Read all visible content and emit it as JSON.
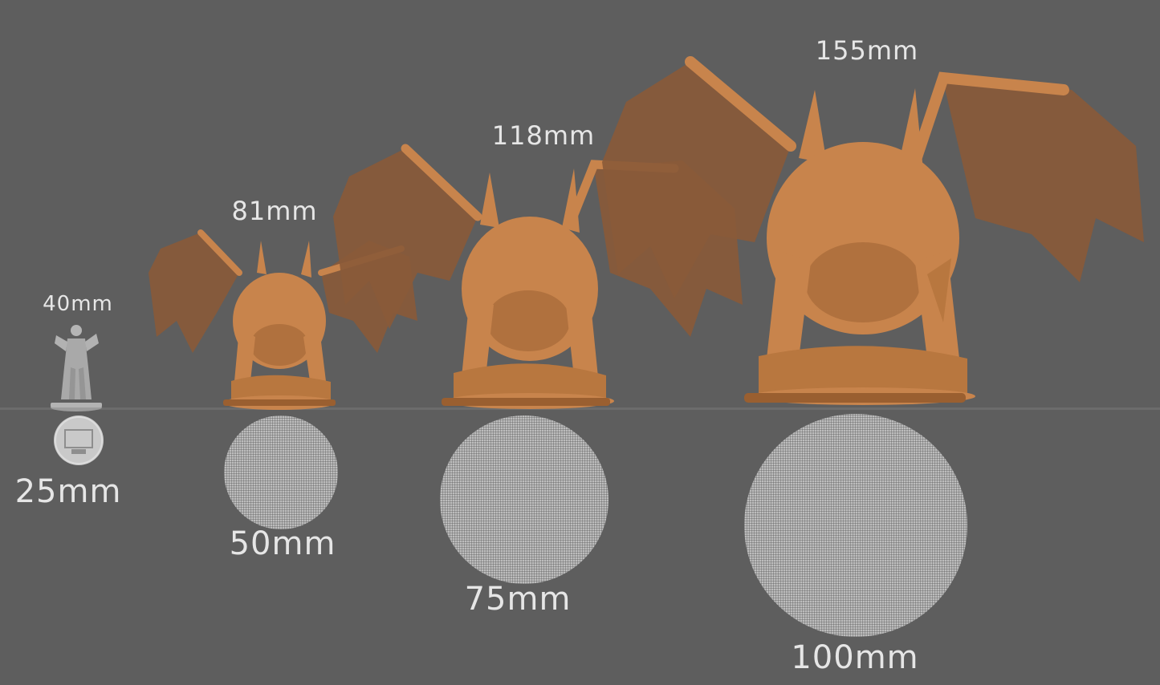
{
  "figures": [
    {
      "height_label": "40mm",
      "base_label": "25mm",
      "color": "#a9a9a9"
    },
    {
      "height_label": "81mm",
      "base_label": "50mm",
      "color": "#c8844c"
    },
    {
      "height_label": "118mm",
      "base_label": "75mm",
      "color": "#c8844c"
    },
    {
      "height_label": "155mm",
      "base_label": "100mm",
      "color": "#c8844c"
    }
  ],
  "colors": {
    "background": "#5e5e5e",
    "model": "#c8844c",
    "model_shadow": "#9a5f30",
    "wing": "#8a5a38",
    "base_disc": "#bdbdbd",
    "text": "#e6e6e6"
  }
}
